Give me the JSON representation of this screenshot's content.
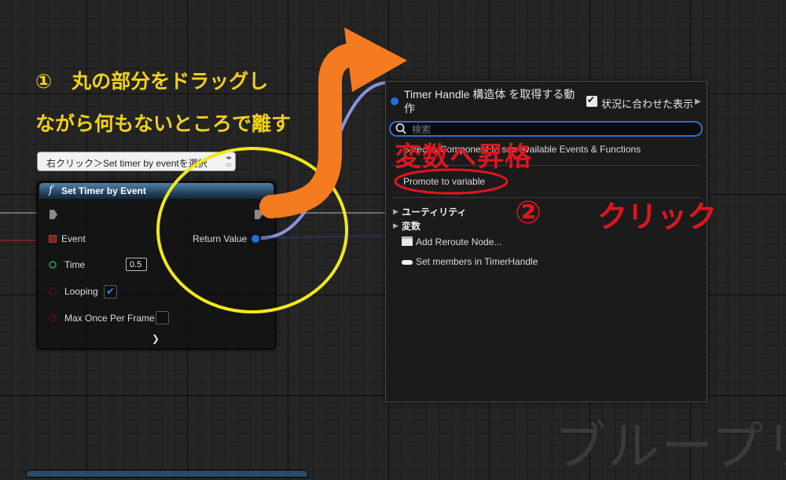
{
  "annotations": {
    "step1_line1": "①　丸の部分をドラッグし",
    "step1_line2": "ながら何もないところで離す",
    "step2_number": "②",
    "step2_text": "クリック",
    "menu_note": "変数へ昇格"
  },
  "comment_bubble": {
    "text": "右クリック＞Set timer by eventを選択"
  },
  "node": {
    "title": "Set Timer by Event",
    "pins": {
      "event": "Event",
      "return_value": "Return Value",
      "time": "Time",
      "time_value": "0.5",
      "looping": "Looping",
      "looping_checked": true,
      "max_once": "Max Once Per Frame",
      "max_once_checked": false
    }
  },
  "context_menu": {
    "title": "Timer Handle 構造体 を取得する動作",
    "context_sensitive_label": "状況に合わせた表示",
    "context_sensitive_checked": true,
    "search_placeholder": "検索",
    "hint": "Select a Component to see available Events & Functions",
    "promote_item": "Promote to variable",
    "categories": [
      "ユーティリティ",
      "変数"
    ],
    "items": [
      "Add Reroute Node...",
      "Set members in TimerHandle"
    ]
  },
  "watermark": "ブループリ",
  "colors": {
    "highlight_yellow": "#f2d21b",
    "arrow_orange": "#f47b20",
    "annotation_red": "#e0141e",
    "exec_pin_gray": "#8a8a8a",
    "struct_pin_blue": "#1f6fe0",
    "accent_blue": "#2f6fc9"
  }
}
